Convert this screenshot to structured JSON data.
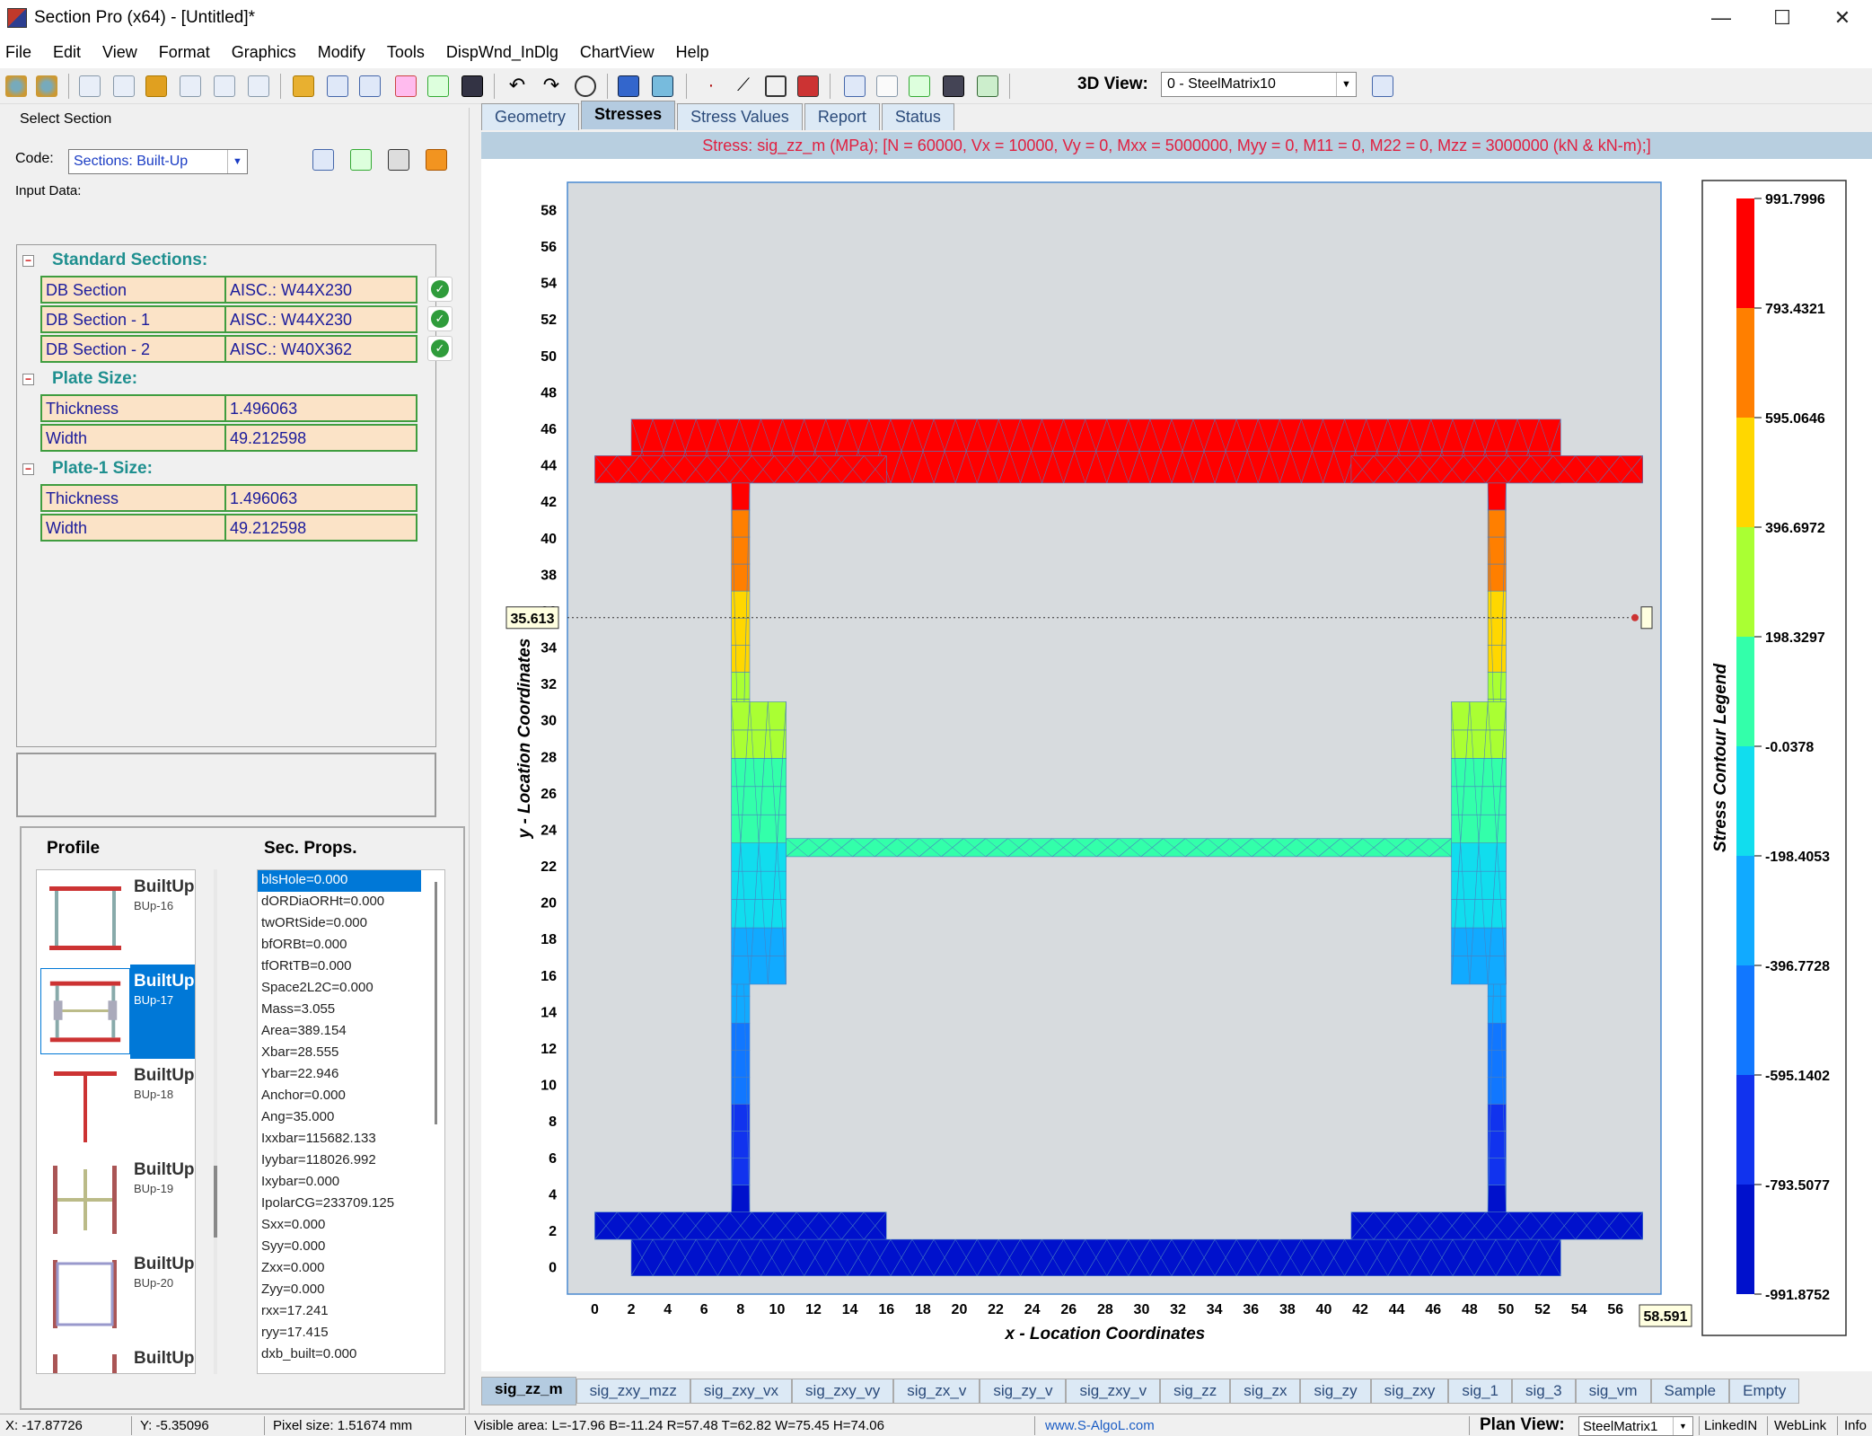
{
  "window": {
    "title": "Section Pro (x64) - [Untitled]*",
    "minimize": "—",
    "maximize": "☐",
    "close": "✕"
  },
  "menu": [
    "File",
    "Edit",
    "View",
    "Format",
    "Graphics",
    "Modify",
    "Tools",
    "DispWnd_InDlg",
    "ChartView",
    "Help"
  ],
  "toolbar": {
    "view3d_label": "3D View:",
    "view3d_value": "0 - SteelMatrix10"
  },
  "left": {
    "select_section": "Select Section",
    "code_label": "Code:",
    "code_value": "Sections: Built-Up",
    "input_data": "Input Data:",
    "groups": [
      {
        "title": "Standard Sections:",
        "rows": [
          {
            "k": "DB Section",
            "v": "AISC.: W44X230"
          },
          {
            "k": "DB Section - 1",
            "v": "AISC.: W44X230"
          },
          {
            "k": "DB Section - 2",
            "v": "AISC.: W40X362"
          }
        ]
      },
      {
        "title": "Plate Size:",
        "rows": [
          {
            "k": "Thickness",
            "v": "1.496063"
          },
          {
            "k": "Width",
            "v": "49.212598"
          }
        ]
      },
      {
        "title": "Plate-1 Size:",
        "rows": [
          {
            "k": "Thickness",
            "v": "1.496063"
          },
          {
            "k": "Width",
            "v": "49.212598"
          }
        ]
      }
    ],
    "profile_header": "Profile",
    "secprops_header": "Sec. Props.",
    "profiles": [
      {
        "name": "BuiltUp",
        "sub": "BUp-16"
      },
      {
        "name": "BuiltUp",
        "sub": "BUp-17",
        "selected": true
      },
      {
        "name": "BuiltUp",
        "sub": "BUp-18"
      },
      {
        "name": "BuiltUp",
        "sub": "BUp-19"
      },
      {
        "name": "BuiltUp",
        "sub": "BUp-20"
      },
      {
        "name": "BuiltUp",
        "sub": ""
      }
    ],
    "secprops": [
      "blsHole=0.000",
      "dORDiaORHt=0.000",
      "twORtSide=0.000",
      "bfORBt=0.000",
      "tfORtTB=0.000",
      "Space2L2C=0.000",
      "Mass=3.055",
      "Area=389.154",
      "Xbar=28.555",
      "Ybar=22.946",
      "Anchor=0.000",
      "Ang=35.000",
      "Ixxbar=115682.133",
      "Iyybar=118026.992",
      "Ixybar=0.000",
      "IpolarCG=233709.125",
      "Sxx=0.000",
      "Syy=0.000",
      "Zxx=0.000",
      "Zyy=0.000",
      "rxx=17.241",
      "ryy=17.415",
      "dxb_built=0.000"
    ]
  },
  "tabs": [
    "Geometry",
    "Stresses",
    "Stress Values",
    "Report",
    "Status"
  ],
  "active_tab": "Stresses",
  "stress_header": "Stress: sig_zz_m (MPa); [N = 60000, Vx = 10000, Vy = 0, Mxx = 5000000, Myy = 0, M11 = 0, M22 = 0, Mzz = 3000000 (kN & kN-m);]",
  "plot": {
    "ylabel": "y - Location Coordinates",
    "xlabel": "x - Location Coordinates",
    "yticks": [
      "0",
      "2",
      "4",
      "6",
      "8",
      "10",
      "12",
      "14",
      "16",
      "18",
      "20",
      "22",
      "24",
      "26",
      "28",
      "30",
      "32",
      "34",
      "36",
      "38",
      "40",
      "42",
      "44",
      "46",
      "48",
      "50",
      "52",
      "54",
      "56",
      "58"
    ],
    "xticks": [
      "0",
      "2",
      "4",
      "6",
      "8",
      "10",
      "12",
      "14",
      "16",
      "18",
      "20",
      "22",
      "24",
      "26",
      "28",
      "30",
      "32",
      "34",
      "36",
      "38",
      "40",
      "42",
      "44",
      "46",
      "48",
      "50",
      "52",
      "54",
      "56"
    ],
    "cursor_y": "35.613",
    "cursor_x": "58.591",
    "legend_title": "Stress Contour Legend",
    "legend_values": [
      "991.7996",
      "793.4321",
      "595.0646",
      "396.6972",
      "198.3297",
      "-0.0378",
      "-198.4053",
      "-396.7728",
      "-595.1402",
      "-793.5077",
      "-991.8752"
    ],
    "legend_colors": [
      "#ff0000",
      "#ff7f00",
      "#ffd700",
      "#aaff33",
      "#33ffaa",
      "#11ddee",
      "#11aaff",
      "#1177ff",
      "#1133ee",
      "#0011cc"
    ]
  },
  "bottom_tabs": [
    "sig_zz_m",
    "sig_zxy_mzz",
    "sig_zxy_vx",
    "sig_zxy_vy",
    "sig_zx_v",
    "sig_zy_v",
    "sig_zxy_v",
    "sig_zz",
    "sig_zx",
    "sig_zy",
    "sig_zxy",
    "sig_1",
    "sig_3",
    "sig_vm",
    "Sample",
    "Empty"
  ],
  "status": {
    "x": "X: -17.87726",
    "y": "Y: -5.35096",
    "pixel": "Pixel size: 1.51674 mm",
    "visible": "Visible area:  L=-17.96  B=-11.24  R=57.48  T=62.82   W=75.45  H=74.06",
    "url": "www.S-AlgoL.com",
    "plan_label": "Plan View:",
    "plan_value": "SteelMatrix1",
    "linkedin": "LinkedIN",
    "weblink": "WebLink",
    "info": "Info"
  }
}
